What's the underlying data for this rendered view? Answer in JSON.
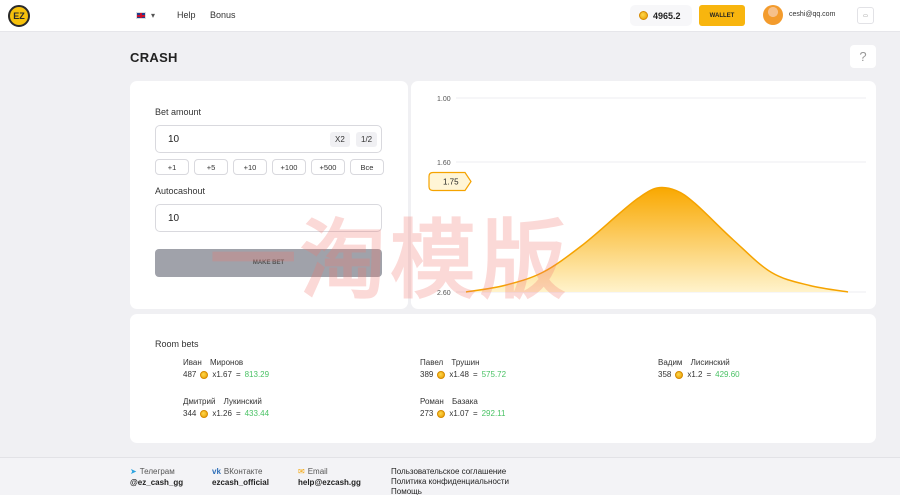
{
  "header": {
    "logo_text": "EZ",
    "nav": [
      "Help",
      "Bonus"
    ],
    "balance": "4965.2",
    "wallet_label": "WALLET",
    "email": "ceshi@qq.com"
  },
  "page_title": "CRASH",
  "help_glyph": "?",
  "bet": {
    "amount_label": "Bet amount",
    "amount_value": "10",
    "x2_label": "X2",
    "half_label": "1/2",
    "chips": [
      "+1",
      "+5",
      "+10",
      "+100",
      "+500",
      "Все"
    ],
    "autocashout_label": "Autocashout",
    "autocashout_value": "10",
    "make_bet_label": "MAKE BET"
  },
  "chart_data": {
    "type": "area",
    "y_tick_labels": [
      "1.00",
      "1.60",
      "2.60"
    ],
    "marker_label": "1.75",
    "x": [
      0,
      0.1,
      0.2,
      0.3,
      0.4,
      0.45,
      0.5,
      0.55,
      0.6,
      0.7,
      0.8,
      0.9,
      1.0
    ],
    "y": [
      2.6,
      2.55,
      2.45,
      2.25,
      2.0,
      1.88,
      1.8,
      1.82,
      1.92,
      2.2,
      2.45,
      2.55,
      2.6
    ],
    "colors": {
      "fill_top": "#f9a800",
      "fill_bottom": "#fff3cc",
      "line": "#f5a300"
    }
  },
  "watermark": "一淘模版",
  "room": {
    "title": "Room bets",
    "bets": [
      {
        "name": "Иван Миронов",
        "amount": "487",
        "mult": "x1.67",
        "eq": "=",
        "win": "813.29"
      },
      {
        "name": "Павел Трушин",
        "amount": "389",
        "mult": "x1.48",
        "eq": "=",
        "win": "575.72"
      },
      {
        "name": "Вадим Лисинский",
        "amount": "358",
        "mult": "x1.2",
        "eq": "=",
        "win": "429.60"
      },
      {
        "name": "Дмитрий Лукинский",
        "amount": "344",
        "mult": "x1.26",
        "eq": "=",
        "win": "433.44"
      },
      {
        "name": "Роман Базака",
        "amount": "273",
        "mult": "x1.07",
        "eq": "=",
        "win": "292.11"
      }
    ]
  },
  "footer": {
    "telegram_label": "Телеграм",
    "telegram_value": "@ez_cash_gg",
    "vk_label": "ВКонтакте",
    "vk_value": "ezcash_official",
    "email_label": "Email",
    "email_value": "help@ezcash.gg",
    "links": [
      "Пользовательское соглашение",
      "Политика конфиденциальности",
      "Помощь"
    ]
  }
}
